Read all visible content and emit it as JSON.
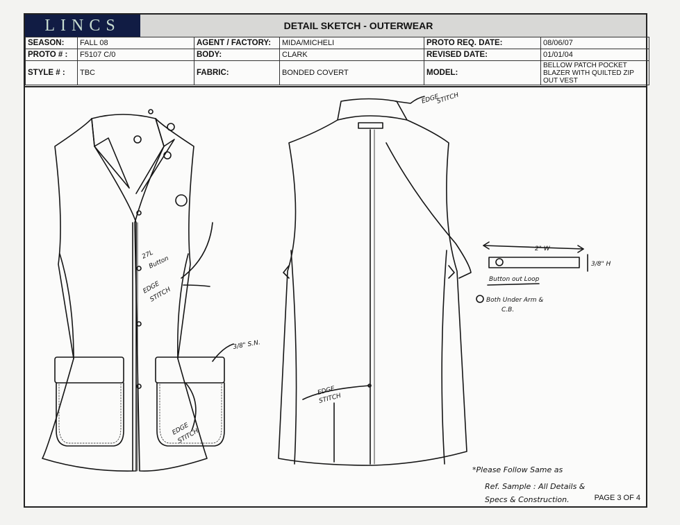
{
  "header": {
    "logo_text": "LINCS",
    "title": "DETAIL SKETCH - OUTERWEAR"
  },
  "info": {
    "season_label": "SEASON:",
    "season_value": "FALL 08",
    "agent_label": "AGENT / FACTORY:",
    "agent_value": "MIDA/MICHELI",
    "proto_req_label": "PROTO REQ. DATE:",
    "proto_req_value": "08/06/07",
    "proto_label": "PROTO # :",
    "proto_value": "F5107 C/0",
    "body_label": "BODY:",
    "body_value": "CLARK",
    "revised_label": "REVISED DATE:",
    "revised_value": "01/01/04",
    "style_label": "STYLE # :",
    "style_value": "TBC",
    "fabric_label": "FABRIC:",
    "fabric_value": "BONDED COVERT",
    "model_label": "MODEL:",
    "model_value": "BELLOW PATCH POCKET BLAZER WITH QUILTED ZIP OUT VEST"
  },
  "annotations": {
    "edge_stitch_collar_1": "EDGE",
    "edge_stitch_collar_2": "STITCH",
    "button_1": "27L",
    "button_2": "Button",
    "edge_front_1": "EDGE",
    "edge_front_2": "STITCH",
    "sn": "3/8\" S.N.",
    "edge_pocket_1": "EDGE",
    "edge_pocket_2": "STITCH",
    "edge_back_1": "EDGE",
    "edge_back_2": "STITCH",
    "width_dim": "2\" W",
    "height_dim": "3/8\" H",
    "loop_label": "Button out Loop",
    "loop_note_1": "Both Under Arm &",
    "loop_note_2": "C.B.",
    "note_1": "*Please Follow Same as",
    "note_2": "Ref. Sample : All Details &",
    "note_3": "Specs & Construction."
  },
  "footer": {
    "page": "PAGE 3 OF 4"
  },
  "colors": {
    "logo_bg": "#111c44",
    "logo_text": "#c7dcd0",
    "header_bg": "#d8d8d6"
  }
}
